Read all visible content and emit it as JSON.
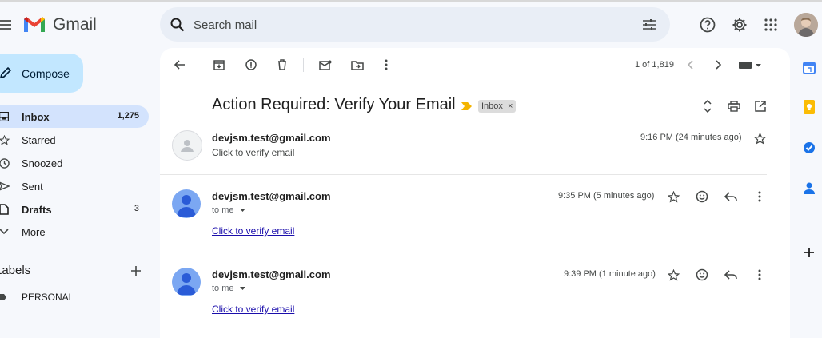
{
  "app": {
    "name": "Gmail"
  },
  "search": {
    "placeholder": "Search mail"
  },
  "sidebar": {
    "compose": "Compose",
    "items": [
      {
        "label": "Inbox",
        "count": "1,275"
      },
      {
        "label": "Starred",
        "count": ""
      },
      {
        "label": "Snoozed",
        "count": ""
      },
      {
        "label": "Sent",
        "count": ""
      },
      {
        "label": "Drafts",
        "count": "3"
      },
      {
        "label": "More",
        "count": ""
      }
    ],
    "labels_title": "Labels",
    "labels": [
      "PERSONAL"
    ]
  },
  "toolbar": {
    "pagination": "1 of 1,819"
  },
  "thread": {
    "subject": "Action Required: Verify Your Email",
    "badge": "Inbox",
    "messages": [
      {
        "from": "devjsm.test@gmail.com",
        "snippet": "Click to verify email",
        "time": "9:16 PM (24 minutes ago)"
      },
      {
        "from": "devjsm.test@gmail.com",
        "to": "to me",
        "time": "9:35 PM (5 minutes ago)",
        "link": "Click to verify email"
      },
      {
        "from": "devjsm.test@gmail.com",
        "to": "to me",
        "time": "9:39 PM (1 minute ago)",
        "link": "Click to verify email"
      }
    ]
  },
  "colors": {
    "accent": "#c2e7ff",
    "active": "#d3e3fd",
    "avatar": "#7ba7f2"
  }
}
